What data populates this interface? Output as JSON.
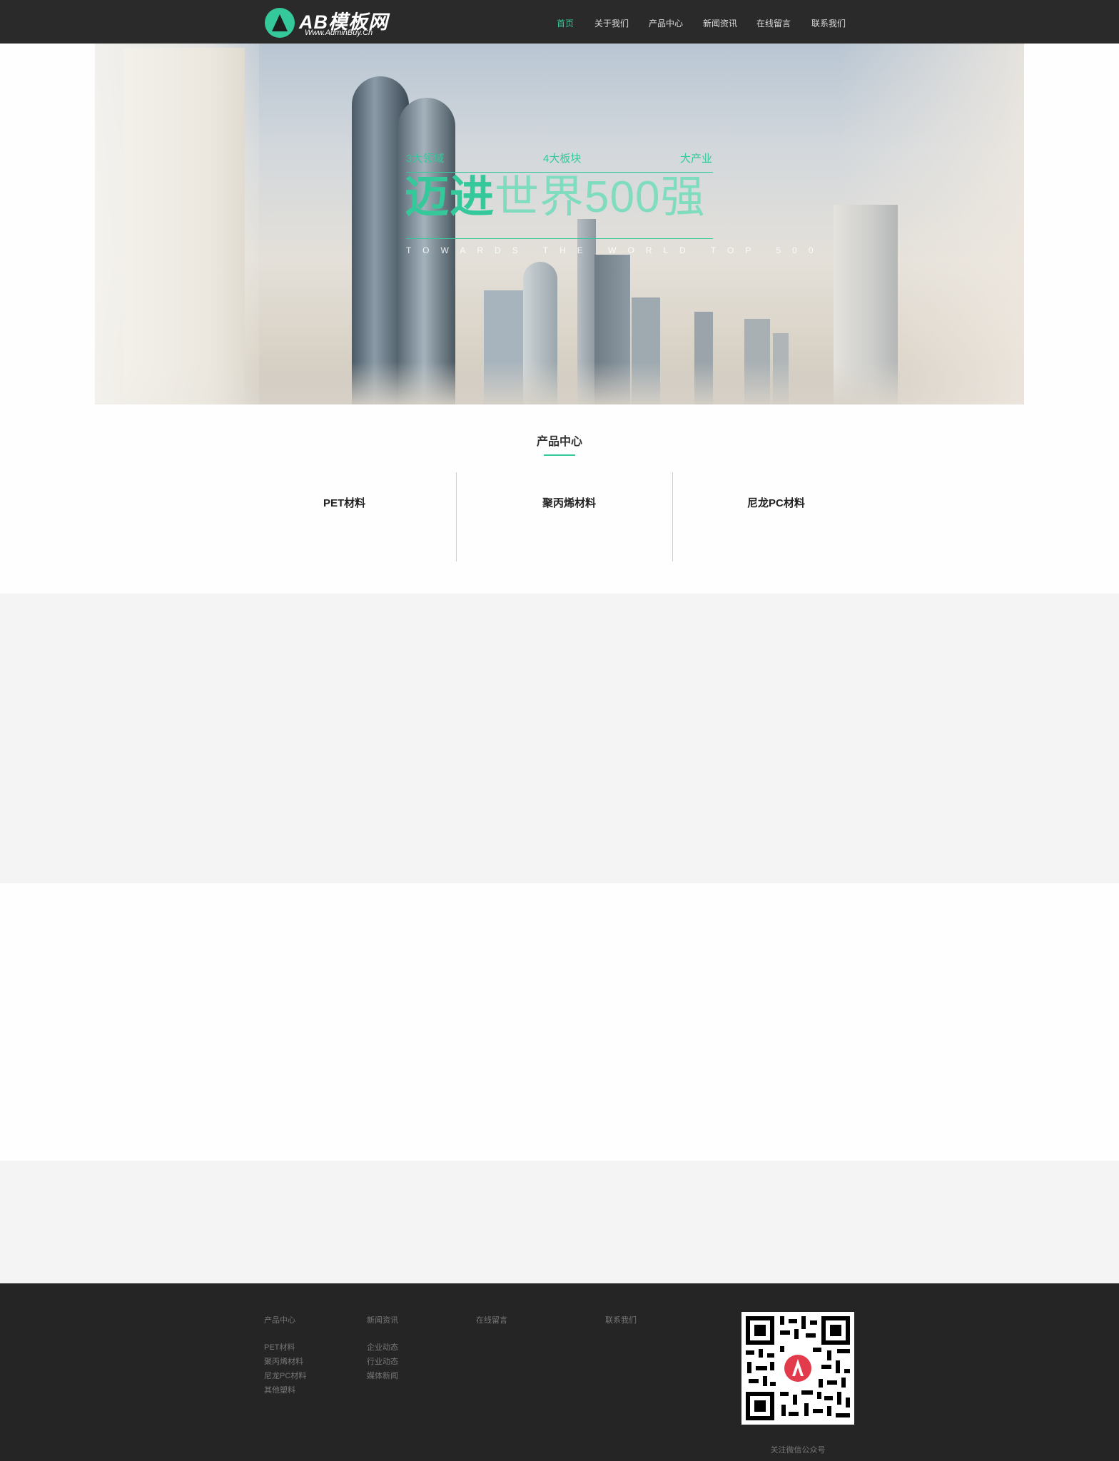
{
  "header": {
    "logo_title": "AB模板网",
    "logo_url": "Www.AdminBuy.Cn",
    "nav": [
      "首页",
      "关于我们",
      "产品中心",
      "新闻资讯",
      "在线留言",
      "联系我们"
    ],
    "accent_color": "#35c89a"
  },
  "banner": {
    "slogan_small": [
      "3大领域",
      "4大板块",
      "大产业"
    ],
    "slogan_main_bold": "迈进",
    "slogan_main_light": "世界500强",
    "slogan_en": "TOWARDS THE WORLD TOP 500"
  },
  "products": {
    "title": "产品中心",
    "categories": [
      "PET材料",
      "聚丙烯材料",
      "尼龙PC材料"
    ]
  },
  "footer": {
    "columns": [
      {
        "title": "产品中心",
        "links": [
          "PET材料",
          "聚丙烯材料",
          "尼龙PC材料",
          "其他塑料"
        ]
      },
      {
        "title": "新闻资讯",
        "links": [
          "企业动态",
          "行业动态",
          "媒体新闻"
        ]
      },
      {
        "title": "在线留言",
        "links": []
      },
      {
        "title": "联系我们",
        "links": []
      }
    ],
    "qr_caption": "关注微信公众号"
  }
}
